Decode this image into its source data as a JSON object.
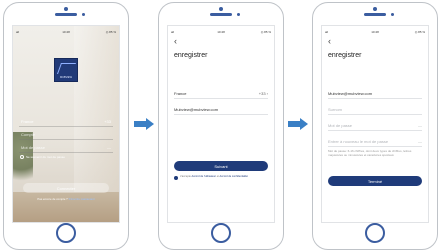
{
  "status_bar": {
    "signal": "all",
    "wifi": "wifi",
    "time": "10:48",
    "battery": "◎ 85 %"
  },
  "screen1": {
    "logo_text": "MUBVIEW",
    "country": "France",
    "country_code": "+33",
    "field_account": "Compte",
    "field_password": "Mot de passe",
    "password_eye": "—",
    "remember_label": "Se souvenir du mot de passe",
    "connect_button": "Connecter",
    "below_text": "Pas encore de compte ?",
    "below_link": "S'inscrire maintenant"
  },
  "screen2": {
    "back": "‹",
    "title": "enregistrer",
    "country": "France",
    "country_code": "+33 ›",
    "email": "Mubview@mubview.com",
    "next_button": "Suivant",
    "agree_prefix": "J'accepte",
    "agree_link1": "Accord de l'utilisateur",
    "agree_and": "et",
    "agree_link2": "Accord de confidentialité"
  },
  "screen3": {
    "back": "‹",
    "title": "enregistrer",
    "email": "Mubview@mubview.com",
    "code": "Surnom",
    "password": "Mot de passe",
    "confirm": "Entrer à nouveau le mot de passe",
    "eye": "—",
    "note": "Mot de passe: 6-16 chiffres, dont deux types de chiffres, lettres majuscules ou minuscules et caractères spéciaux",
    "done_button": "Terminé"
  }
}
